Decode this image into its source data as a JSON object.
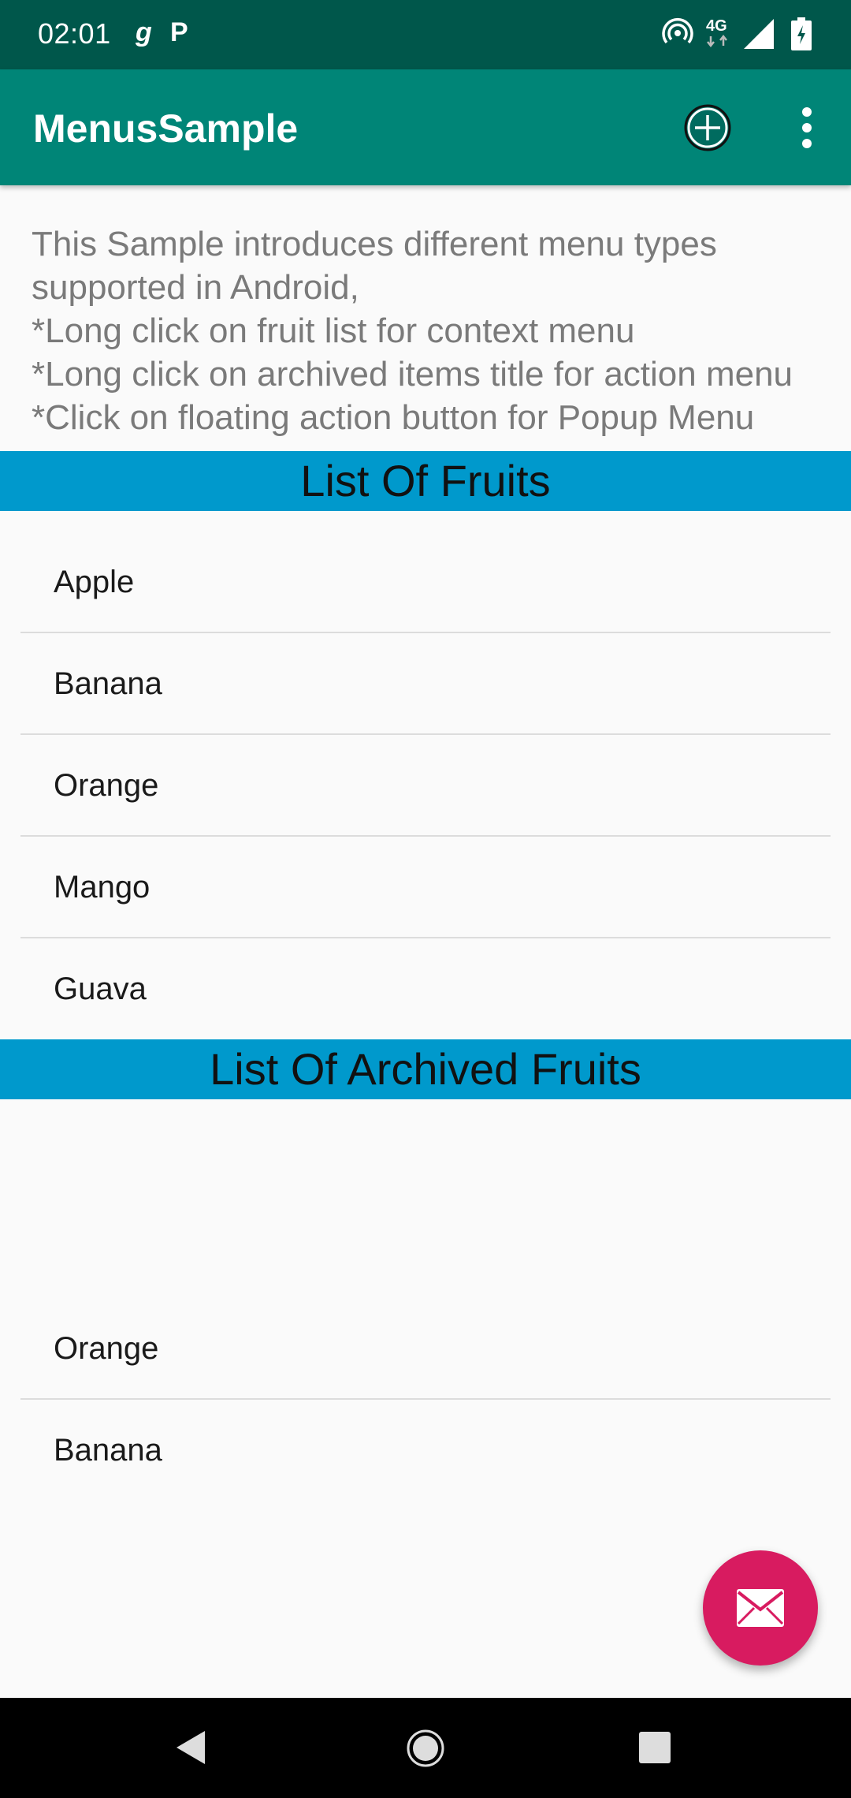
{
  "status_bar": {
    "time": "02:01",
    "notif_icon_1": "g",
    "notif_icon_2": "P",
    "network_label": "4G"
  },
  "app_bar": {
    "title": "MenusSample",
    "icons": [
      "add-circle-icon",
      "more-vert-icon"
    ]
  },
  "description": {
    "lines": [
      "This Sample introduces different menu types",
      "supported in Android,",
      "*Long click on fruit list for context menu",
      "*Long click on archived items title for action menu",
      "*Click on floating action button for Popup Menu"
    ]
  },
  "fruits": {
    "header": "List Of Fruits",
    "items": [
      "Apple",
      "Banana",
      "Orange",
      "Mango",
      "Guava"
    ]
  },
  "archived": {
    "header": "List Of Archived Fruits",
    "items": [
      "Orange",
      "Banana"
    ]
  },
  "fab": {
    "icon": "mail-icon"
  },
  "colors": {
    "status_bar": "#00574b",
    "app_bar": "#008577",
    "section_header": "#0099cc",
    "fab": "#d81b60"
  }
}
